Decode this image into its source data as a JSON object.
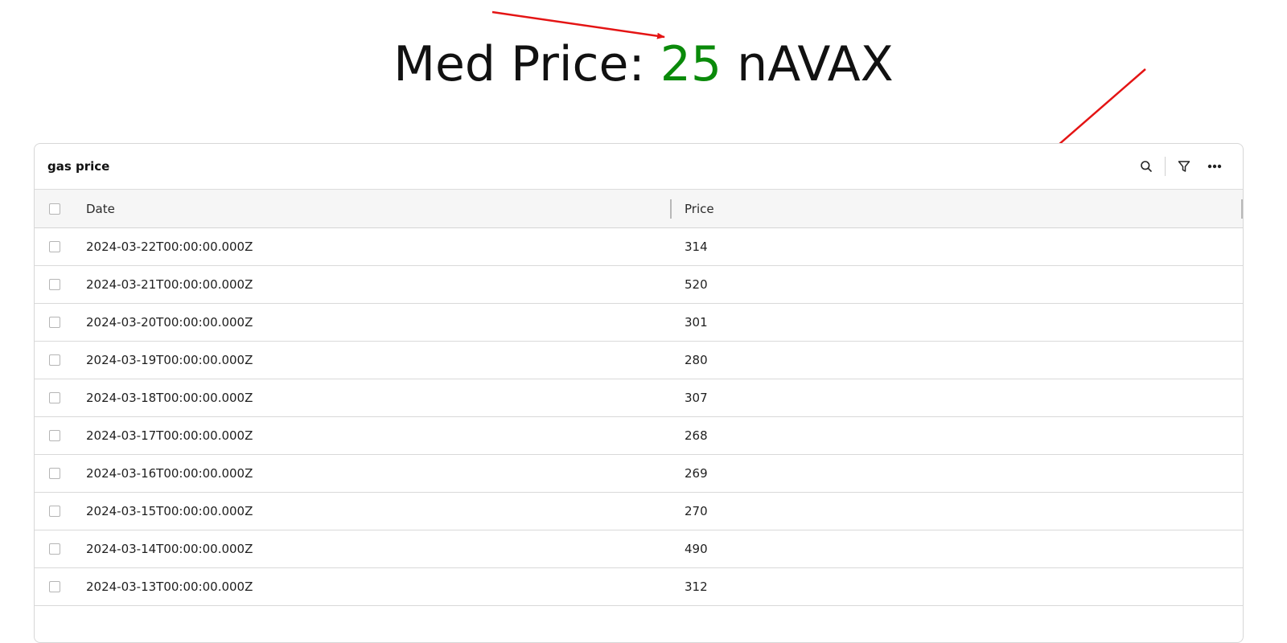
{
  "headline": {
    "label": "Med Price:",
    "value": "25",
    "unit": "nAVAX",
    "value_color": "#0a8a0a"
  },
  "annotation_color": "#e41414",
  "panel": {
    "title": "gas price",
    "toolbar": {
      "search_icon": "search-icon",
      "filter_icon": "filter-icon",
      "more_icon": "more-horizontal-icon"
    }
  },
  "table": {
    "columns": [
      "Date",
      "Price"
    ],
    "rows": [
      [
        "2024-03-22T00:00:00.000Z",
        "314"
      ],
      [
        "2024-03-21T00:00:00.000Z",
        "520"
      ],
      [
        "2024-03-20T00:00:00.000Z",
        "301"
      ],
      [
        "2024-03-19T00:00:00.000Z",
        "280"
      ],
      [
        "2024-03-18T00:00:00.000Z",
        "307"
      ],
      [
        "2024-03-17T00:00:00.000Z",
        "268"
      ],
      [
        "2024-03-16T00:00:00.000Z",
        "269"
      ],
      [
        "2024-03-15T00:00:00.000Z",
        "270"
      ],
      [
        "2024-03-14T00:00:00.000Z",
        "490"
      ],
      [
        "2024-03-13T00:00:00.000Z",
        "312"
      ]
    ]
  }
}
